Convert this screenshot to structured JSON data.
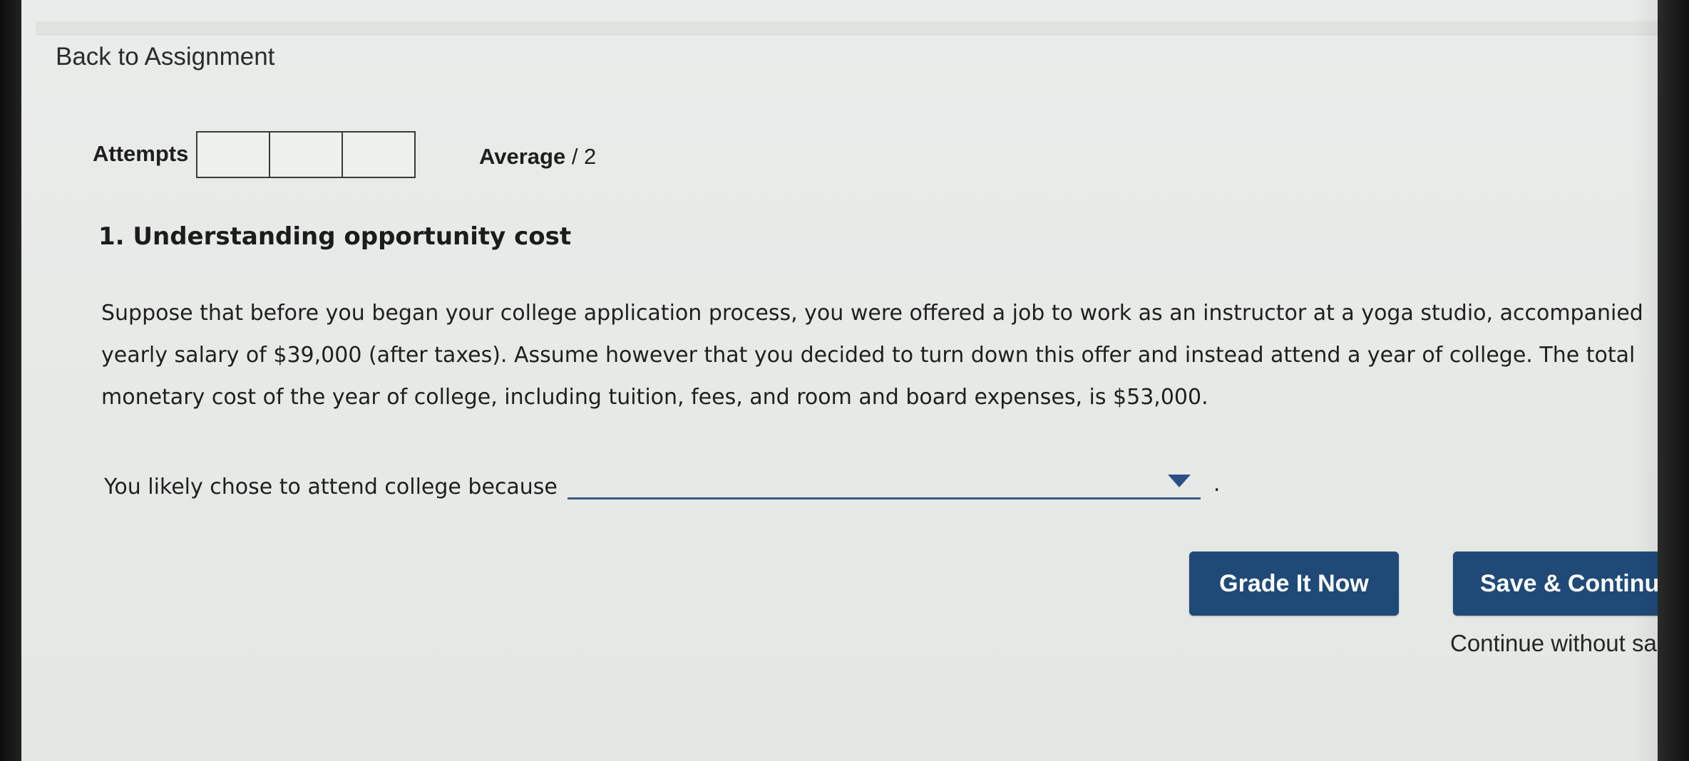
{
  "nav": {
    "back_label": "Back to Assignment"
  },
  "score": {
    "attempts_label": "Attempts",
    "attempt_boxes": [
      "",
      "",
      ""
    ],
    "average_label": "Average",
    "average_value": "/ 2"
  },
  "question": {
    "title": "1. Understanding opportunity cost",
    "body_lines": [
      "Suppose that before you began your college application process, you were offered a job to work as an instructor at a yoga studio, accompanied",
      "yearly salary of $39,000 (after taxes). Assume however that you decided to turn down this offer and instead attend a year of college. The total",
      "monetary cost of the year of college, including tuition, fees, and room and board expenses, is $53,000."
    ],
    "prompt": "You likely chose to attend college because",
    "dropdown_value": "",
    "prompt_end": "."
  },
  "actions": {
    "grade_label": "Grade It Now",
    "save_label": "Save & Continu",
    "continue_label": "Continue without sa"
  },
  "colors": {
    "button_bg": "#1f4a78",
    "dropdown_line": "#3d5a80",
    "chevron": "#2c4f86"
  }
}
